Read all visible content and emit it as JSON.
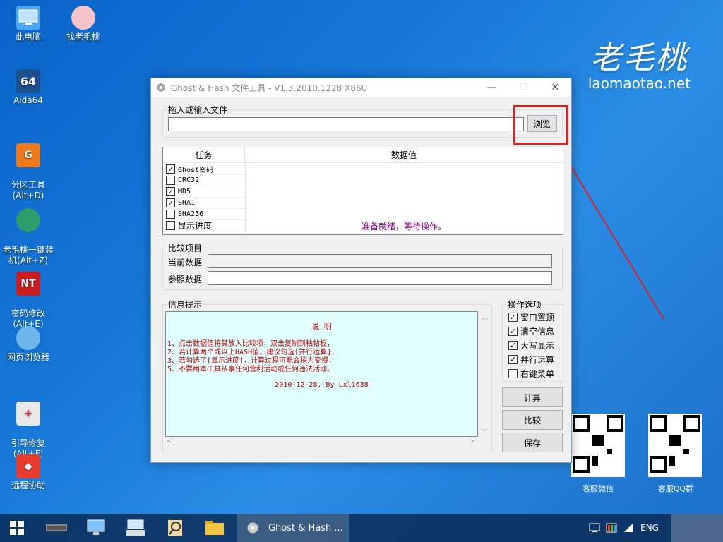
{
  "desktop": {
    "icons": [
      {
        "label": "此电脑"
      },
      {
        "label": "找老毛桃"
      },
      {
        "label": "Aida64"
      },
      {
        "label": "分区工具\n(Alt+D)"
      },
      {
        "label": "老毛桃一键装\n机(Alt+Z)"
      },
      {
        "label": "密码修改\n(Alt+E)"
      },
      {
        "label": "网页浏览器"
      },
      {
        "label": "引导修复\n(Alt+F)"
      },
      {
        "label": "远程协助"
      }
    ],
    "brand_title": "老毛桃",
    "brand_url": "laomaotao.net",
    "qr_labels": [
      "客服微信",
      "客服QQ群"
    ]
  },
  "window": {
    "title": "Ghost & Hash 文件工具 - V1.3.2010.1228 X86U",
    "file_group_label": "拖入或输入文件",
    "file_input_value": "",
    "browse_label": "浏览",
    "task_header": "任务",
    "value_header": "数据值",
    "tasks": [
      {
        "name": "Ghost密码",
        "checked": true
      },
      {
        "name": "CRC32",
        "checked": false
      },
      {
        "name": "MD5",
        "checked": true
      },
      {
        "name": "SHA1",
        "checked": true
      },
      {
        "name": "SHA256",
        "checked": false
      },
      {
        "name": "显示进度",
        "checked": false
      }
    ],
    "status_text": "准备就绪，等待操作。",
    "compare_group_label": "比较项目",
    "current_data_label": "当前数据",
    "reference_data_label": "参照数据",
    "info_group_label": "信息提示",
    "info_title": "说 明",
    "info_lines": [
      "1、点击数据值将其放入比较项，双击复制到粘帖板，",
      "2、若计算两个或以上HASH值，建议勾选[并行运算]，",
      "3、若勾选了[显示进度]，计算过程可能会稍为变慢，",
      "5、不要用本工具从事任何营利活动或任何违法活动。"
    ],
    "info_footer": "2010-12-28, By Lxl1638",
    "options_group_label": "操作选项",
    "options": [
      {
        "label": "窗口置顶",
        "checked": true
      },
      {
        "label": "清空信息",
        "checked": true
      },
      {
        "label": "大写显示",
        "checked": true
      },
      {
        "label": "并行运算",
        "checked": true
      },
      {
        "label": "右键菜单",
        "checked": false
      }
    ],
    "calc_label": "计算",
    "compare_label": "比较",
    "save_label": "保存"
  },
  "taskbar": {
    "active_app_label": "Ghost & Hash ...",
    "lang": "ENG"
  },
  "colors": {
    "highlight_red": "#e02020",
    "status_purple": "#800080",
    "info_text_red": "#c00000",
    "info_bg": "#e0ffff"
  }
}
